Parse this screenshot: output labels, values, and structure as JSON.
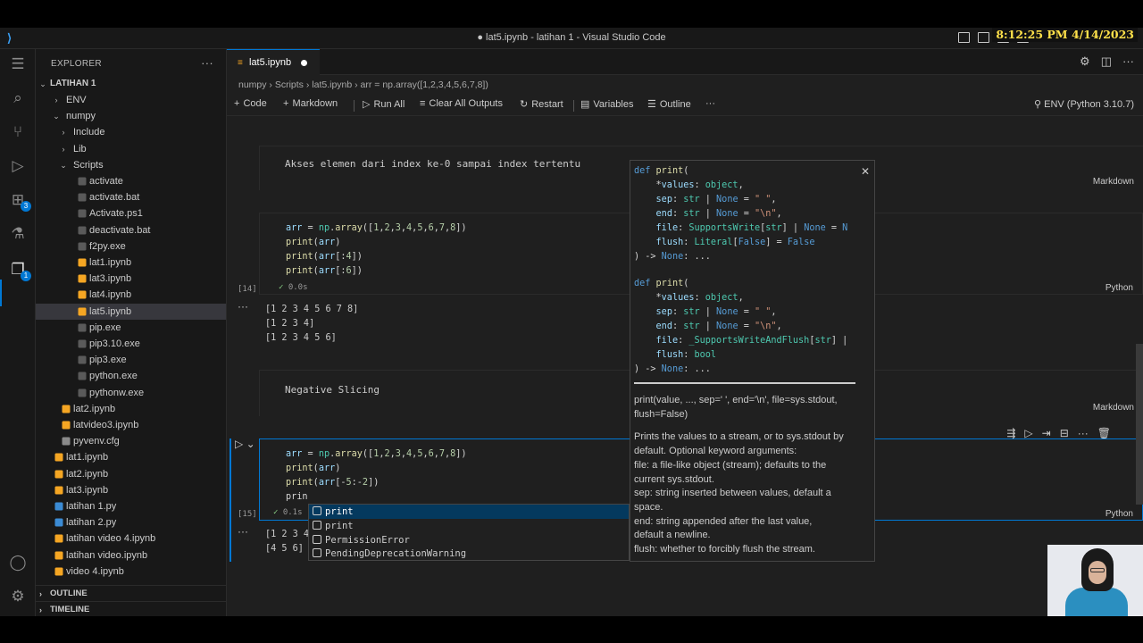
{
  "clock": "8:12:25 PM 4/14/2023",
  "window": {
    "title": "● lat5.ipynb - latihan 1 - Visual Studio Code"
  },
  "explorer": {
    "header": "EXPLORER",
    "root": "LATIHAN 1",
    "items": [
      {
        "label": "ENV",
        "type": "folder",
        "depth": 1,
        "open": false
      },
      {
        "label": "numpy",
        "type": "folder",
        "depth": 1,
        "open": true
      },
      {
        "label": "Include",
        "type": "folder",
        "depth": 2,
        "open": false
      },
      {
        "label": "Lib",
        "type": "folder",
        "depth": 2,
        "open": false
      },
      {
        "label": "Scripts",
        "type": "folder",
        "depth": 2,
        "open": true
      },
      {
        "label": "activate",
        "type": "file",
        "depth": 3
      },
      {
        "label": "activate.bat",
        "type": "file",
        "depth": 3
      },
      {
        "label": "Activate.ps1",
        "type": "file",
        "depth": 3
      },
      {
        "label": "deactivate.bat",
        "type": "file",
        "depth": 3
      },
      {
        "label": "f2py.exe",
        "type": "file",
        "depth": 3
      },
      {
        "label": "lat1.ipynb",
        "type": "file",
        "depth": 3
      },
      {
        "label": "lat3.ipynb",
        "type": "file",
        "depth": 3
      },
      {
        "label": "lat4.ipynb",
        "type": "file",
        "depth": 3
      },
      {
        "label": "lat5.ipynb",
        "type": "file",
        "depth": 3,
        "selected": true
      },
      {
        "label": "pip.exe",
        "type": "file",
        "depth": 3
      },
      {
        "label": "pip3.10.exe",
        "type": "file",
        "depth": 3
      },
      {
        "label": "pip3.exe",
        "type": "file",
        "depth": 3
      },
      {
        "label": "python.exe",
        "type": "file",
        "depth": 3
      },
      {
        "label": "pythonw.exe",
        "type": "file",
        "depth": 3
      },
      {
        "label": "lat2.ipynb",
        "type": "file",
        "depth": 2
      },
      {
        "label": "latvideo3.ipynb",
        "type": "file",
        "depth": 2
      },
      {
        "label": "pyvenv.cfg",
        "type": "gear",
        "depth": 2
      },
      {
        "label": "lat1.ipynb",
        "type": "file",
        "depth": 1
      },
      {
        "label": "lat2.ipynb",
        "type": "file",
        "depth": 1
      },
      {
        "label": "lat3.ipynb",
        "type": "file",
        "depth": 1
      },
      {
        "label": "latihan 1.py",
        "type": "py",
        "depth": 1
      },
      {
        "label": "latihan 2.py",
        "type": "py",
        "depth": 1
      },
      {
        "label": "latihan video 4.ipynb",
        "type": "file",
        "depth": 1
      },
      {
        "label": "latihan video.ipynb",
        "type": "file",
        "depth": 1
      },
      {
        "label": "video 4.ipynb",
        "type": "file",
        "depth": 1
      }
    ],
    "outline": "OUTLINE",
    "timeline": "TIMELINE"
  },
  "tab": {
    "name": "lat5.ipynb"
  },
  "breadcrumb": "numpy › Scripts › lat5.ipynb › arr = np.array([1,2,3,4,5,6,7,8])",
  "toolbar": {
    "code": "Code",
    "markdown": "Markdown",
    "run_all": "Run All",
    "clear": "Clear All Outputs",
    "restart": "Restart",
    "variables": "Variables",
    "outline": "Outline",
    "more": "···",
    "kernel": "ENV (Python 3.10.7)"
  },
  "cells": {
    "md1": {
      "text": "Akses elemen dari index ke-0 sampai index tertentu",
      "kind": "Markdown"
    },
    "code1": {
      "lines": [
        "arr = np.array([1,2,3,4,5,6,7,8])",
        "print(arr)",
        "print(arr[:4])",
        "print(arr[:6])"
      ],
      "exec_count": "[14]",
      "time": "0.0s",
      "kind": "Python",
      "output": [
        "[1 2 3 4 5 6 7 8]",
        "[1 2 3 4]",
        "[1 2 3 4 5 6]"
      ]
    },
    "md2": {
      "text": "Negative Slicing",
      "kind": "Markdown"
    },
    "code2": {
      "lines": [
        "arr = np.array([1,2,3,4,5,6,7,8])",
        "print(arr)",
        "print(arr[-5:-2])",
        "prin"
      ],
      "exec_count": "[15]",
      "time": "0.1s",
      "kind": "Python",
      "output": [
        "[1 2 3 4",
        "[4 5 6]"
      ]
    }
  },
  "hover": {
    "sig1": [
      "def print(",
      "    *values: object,",
      "    sep: str | None = \" \",",
      "    end: str | None = \"\\n\",",
      "    file: SupportsWrite[str] | None = N",
      "    flush: Literal[False] = False",
      ") -> None: ..."
    ],
    "sig2": [
      "def print(",
      "    *values: object,",
      "    sep: str | None = \" \",",
      "    end: str | None = \"\\n\",",
      "    file: _SupportsWriteAndFlush[str] |",
      "    flush: bool",
      ") -> None: ..."
    ],
    "doc": [
      "print(value, ..., sep=' ', end='\\n', file=sys.stdout,",
      "flush=False)",
      "",
      "Prints the values to a stream, or to sys.stdout by",
      "default. Optional keyword arguments:",
      "file: a file-like object (stream); defaults to the",
      "current sys.stdout.",
      "sep: string inserted between values, default a",
      "space.",
      "end: string appended after the last value,",
      "default a newline.",
      "flush: whether to forcibly flush the stream."
    ]
  },
  "suggest": [
    {
      "label": "print",
      "match": "prin",
      "rest": "t"
    },
    {
      "label": "print",
      "match": "prin",
      "rest": "t"
    },
    {
      "label": "PermissionError",
      "match": "",
      "rest": "PermissionError"
    },
    {
      "label": "PendingDeprecationWarning",
      "match": "",
      "rest": "PendingDeprecationWarning"
    }
  ]
}
